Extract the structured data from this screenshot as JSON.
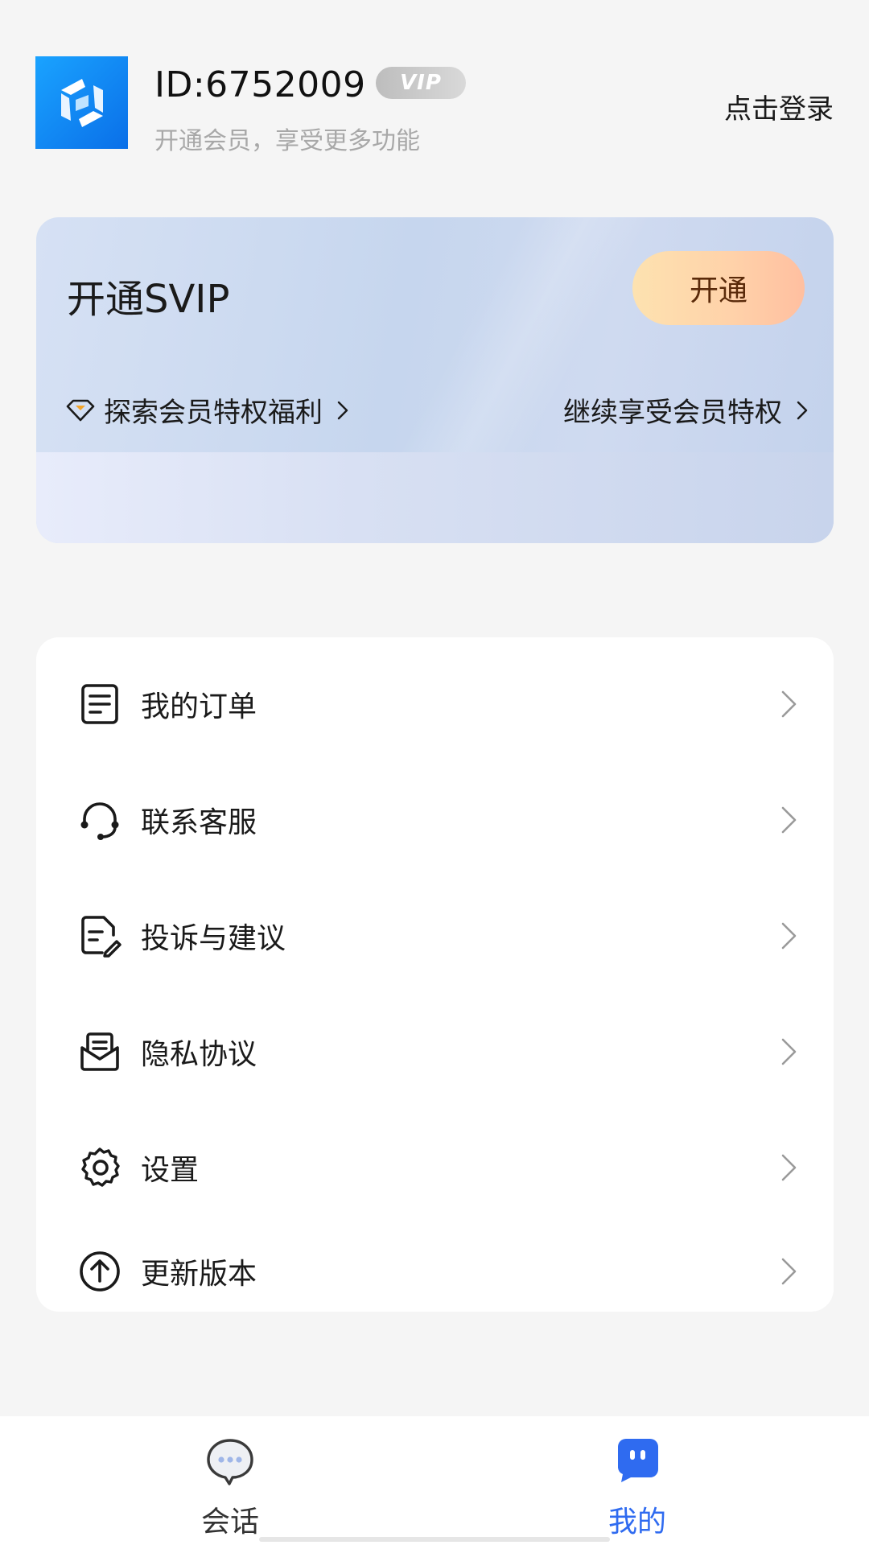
{
  "header": {
    "user_id": "ID:6752009",
    "vip_badge": "VIP",
    "subtitle": "开通会员，享受更多功能",
    "login_label": "点击登录"
  },
  "svip_card": {
    "title": "开通SVIP",
    "open_button": "开通",
    "explore_label": "探索会员特权福利",
    "continue_label": "继续享受会员特权"
  },
  "menu": {
    "items": [
      {
        "label": "我的订单",
        "icon": "order-icon"
      },
      {
        "label": "联系客服",
        "icon": "headset-icon"
      },
      {
        "label": "投诉与建议",
        "icon": "feedback-icon"
      },
      {
        "label": "隐私协议",
        "icon": "envelope-icon"
      },
      {
        "label": "设置",
        "icon": "gear-icon"
      },
      {
        "label": "更新版本",
        "icon": "upload-icon"
      }
    ]
  },
  "bottom_nav": {
    "items": [
      {
        "label": "会话",
        "icon": "chat-bubble-icon",
        "active": false
      },
      {
        "label": "我的",
        "icon": "robot-face-icon",
        "active": true
      }
    ]
  },
  "colors": {
    "accent": "#2f6bf0",
    "open_button_gradient_start": "#fde2b0",
    "open_button_gradient_end": "#ffbfa0"
  }
}
